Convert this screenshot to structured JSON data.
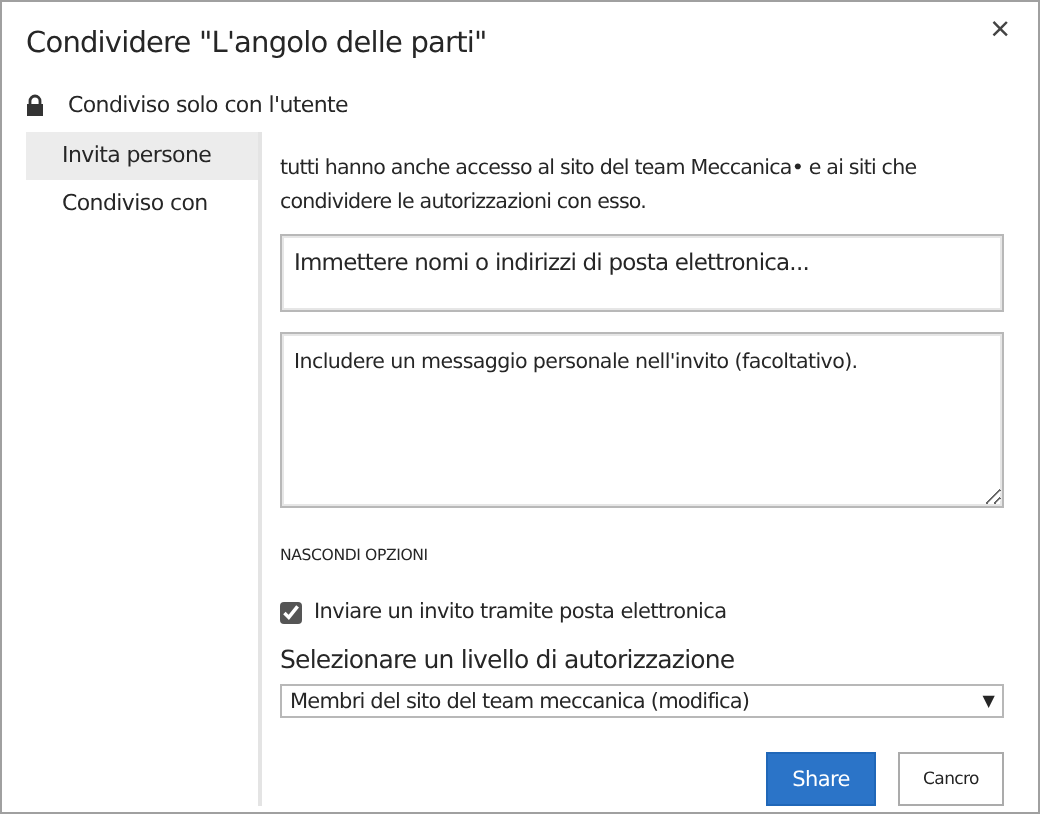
{
  "window": {
    "title": "Condividere \"L'angolo delle parti\"",
    "close": "×"
  },
  "sharing_status": "Condiviso solo con l'utente",
  "sidebar": {
    "items": [
      {
        "label": "Invita persone",
        "selected": true
      },
      {
        "label": "Condiviso con",
        "selected": false
      }
    ]
  },
  "intro": "tutti hanno anche accesso al sito del team Meccanica• e ai siti che condividere le autorizzazioni con esso.",
  "people_field": {
    "placeholder": "Immettere nomi o indirizzi di posta elettronica..."
  },
  "message_field": {
    "placeholder": "Includere un messaggio personale nell'invito (facoltativo)."
  },
  "options_link": "NASCONDI OPZIONI",
  "send_invite": {
    "label": "Inviare un invito tramite posta elettronica",
    "checked": true
  },
  "permission": {
    "label": "Selezionare un livello di autorizzazione",
    "value": "Membri del sito del team meccanica (modifica)",
    "caret": "▼"
  },
  "buttons": [
    {
      "label": "Share",
      "kind": "primary"
    },
    {
      "label": "Cancro",
      "kind": "secondary"
    }
  ]
}
